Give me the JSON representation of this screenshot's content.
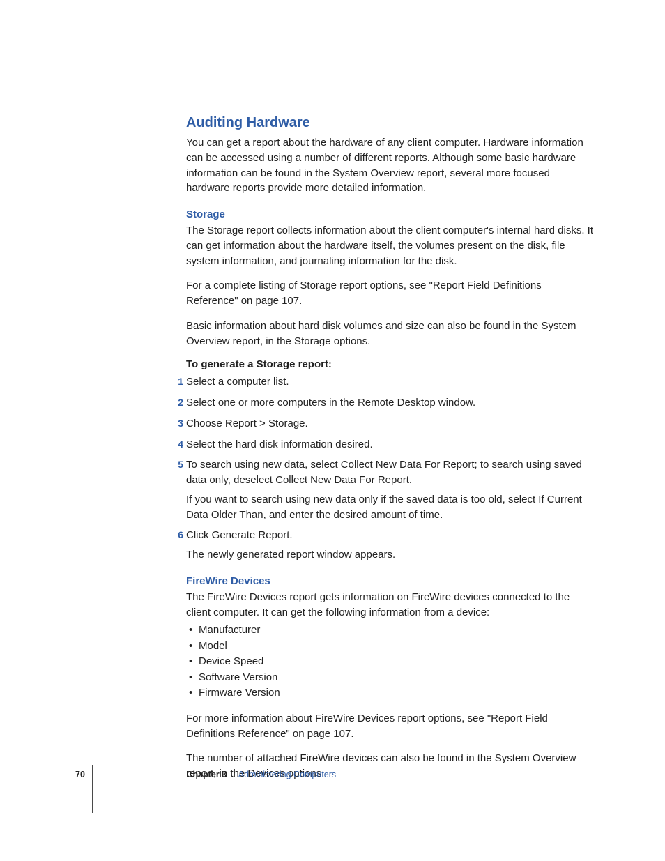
{
  "heading1": "Auditing Hardware",
  "intro": "You can get a report about the hardware of any client computer. Hardware information can be accessed using a number of different reports. Although some basic hardware information can be found in the System Overview report, several more focused hardware reports provide more detailed information.",
  "storage": {
    "title": "Storage",
    "p1": "The Storage report collects information about the client computer's internal hard disks. It can get information about the hardware itself, the volumes present on the disk, file system information, and journaling information for the disk.",
    "p2": "For a complete listing of Storage report options, see \"Report Field Definitions Reference\" on page 107.",
    "p3": "Basic information about hard disk volumes and size can also be found in the System Overview report, in the Storage options.",
    "howto": "To generate a Storage report:",
    "steps": [
      {
        "n": "1",
        "t": "Select a computer list."
      },
      {
        "n": "2",
        "t": "Select one or more computers in the Remote Desktop window."
      },
      {
        "n": "3",
        "t": "Choose Report > Storage."
      },
      {
        "n": "4",
        "t": "Select the hard disk information desired."
      },
      {
        "n": "5",
        "t": "To search using new data, select Collect New Data For Report; to search using saved data only, deselect Collect New Data For Report.",
        "sub": "If you want to search using new data only if the saved data is too old, select If Current Data Older Than, and enter the desired amount of time."
      },
      {
        "n": "6",
        "t": "Click Generate Report.",
        "sub": "The newly generated report window appears."
      }
    ]
  },
  "firewire": {
    "title": "FireWire Devices",
    "p1": "The FireWire Devices report gets information on FireWire devices connected to the client computer. It can get the following information from a device:",
    "bullets": [
      "Manufacturer",
      "Model",
      "Device Speed",
      "Software Version",
      "Firmware Version"
    ],
    "p2": "For more information about FireWire Devices report options, see \"Report Field Definitions Reference\" on page 107.",
    "p3": "The number of attached FireWire devices can also be found in the System Overview report, in the Devices options."
  },
  "footer": {
    "page": "70",
    "chapter_label": "Chapter 3",
    "chapter_title": "Administering Computers"
  }
}
